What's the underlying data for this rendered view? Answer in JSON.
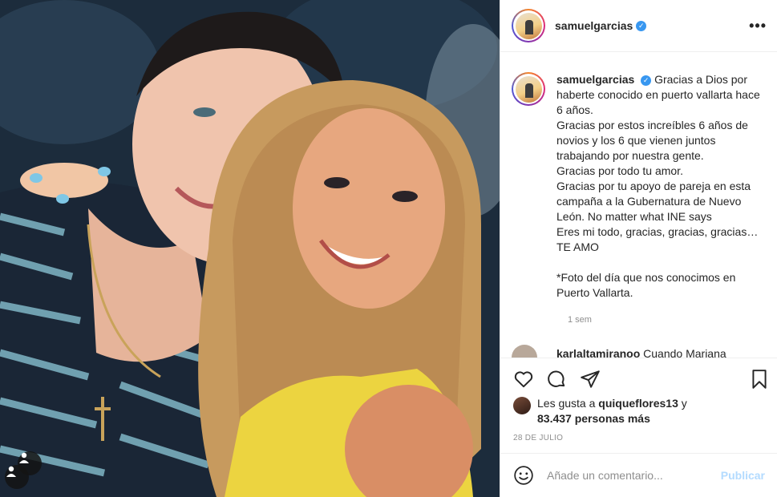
{
  "post": {
    "username": "samuelgarcias",
    "verified": true,
    "more_icon": "more-options-icon",
    "photo_alt": "Couple photo"
  },
  "caption": {
    "username": "samuelgarcias",
    "lines": [
      "Gracias a Dios por haberte conocido en puerto vallarta hace 6 años.",
      "Gracias por estos increíbles 6 años de novios y los 6 que vienen juntos trabajando por nuestra gente.",
      "Gracias por todo tu amor.",
      "Gracias por tu apoyo de pareja en esta campaña a la Gubernatura de Nuevo León. No matter what INE says",
      "Eres mi todo, gracias, gracias, gracias…",
      "TE AMO",
      "",
      "*Foto del día que nos conocimos en Puerto Vallarta."
    ],
    "time": "1 sem"
  },
  "comment_peek": {
    "username": "karlaltamiranoo",
    "text": "Cuando Mariana"
  },
  "likes": {
    "prefix": "Les gusta a",
    "user": "quiqueflores13",
    "conjunction": "y",
    "count": "83.437 personas más"
  },
  "date": "28 DE JULIO",
  "add_comment": {
    "placeholder": "Añade un comentario...",
    "publish_label": "Publicar"
  },
  "colors": {
    "accent": "#3897f0",
    "publish_disabled": "#b3dbff",
    "muted": "#8e8e8e"
  }
}
